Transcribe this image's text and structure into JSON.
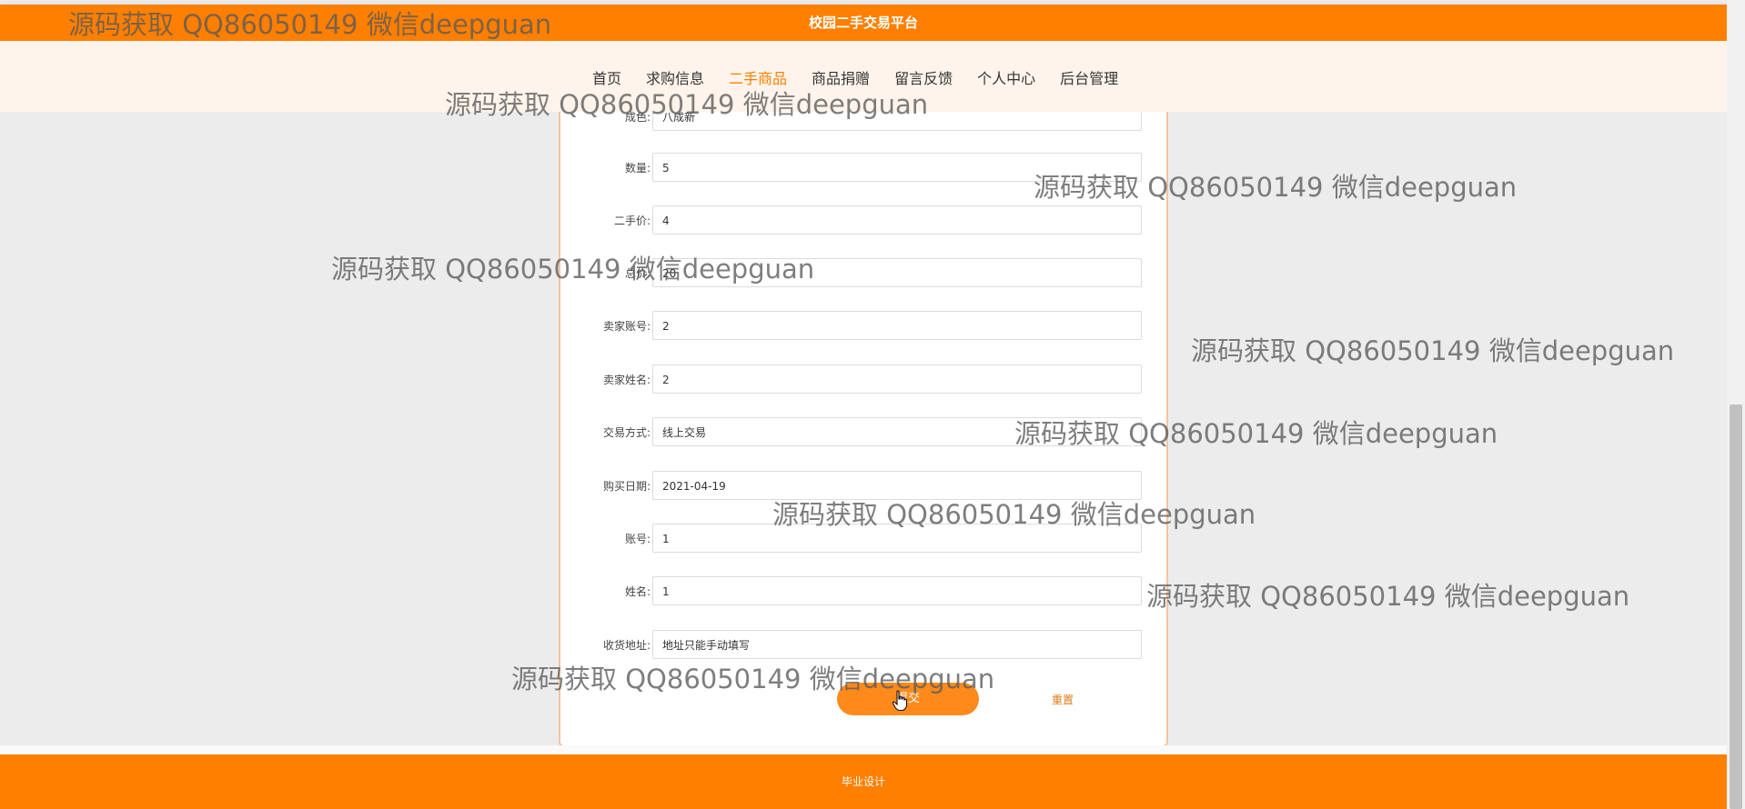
{
  "header": {
    "title": "校园二手交易平台"
  },
  "nav": {
    "items": [
      {
        "label": "首页"
      },
      {
        "label": "求购信息"
      },
      {
        "label": "二手商品"
      },
      {
        "label": "商品捐赠"
      },
      {
        "label": "留言反馈"
      },
      {
        "label": "个人中心"
      },
      {
        "label": "后台管理"
      }
    ],
    "active_index": 2
  },
  "form": {
    "fields": [
      {
        "label": "成色:",
        "value": "八成新"
      },
      {
        "label": "数量:",
        "value": "5"
      },
      {
        "label": "二手价:",
        "value": "4"
      },
      {
        "label": "总价:",
        "value": "20"
      },
      {
        "label": "卖家账号:",
        "value": "2"
      },
      {
        "label": "卖家姓名:",
        "value": "2"
      },
      {
        "label": "交易方式:",
        "value": "线上交易"
      },
      {
        "label": "购买日期:",
        "value": "2021-04-19"
      },
      {
        "label": "账号:",
        "value": "1"
      },
      {
        "label": "姓名:",
        "value": "1"
      },
      {
        "label": "收货地址:",
        "value": "地址只能手动填写"
      }
    ],
    "submit_label": "提交",
    "reset_label": "重置"
  },
  "footer": {
    "text": "毕业设计"
  },
  "watermark": {
    "text": "源码获取 QQ86050149 微信deepguan"
  },
  "colors": {
    "accent": "#ff7f00",
    "nav_bg": "#fff4eb",
    "page_bg": "#ececec"
  }
}
